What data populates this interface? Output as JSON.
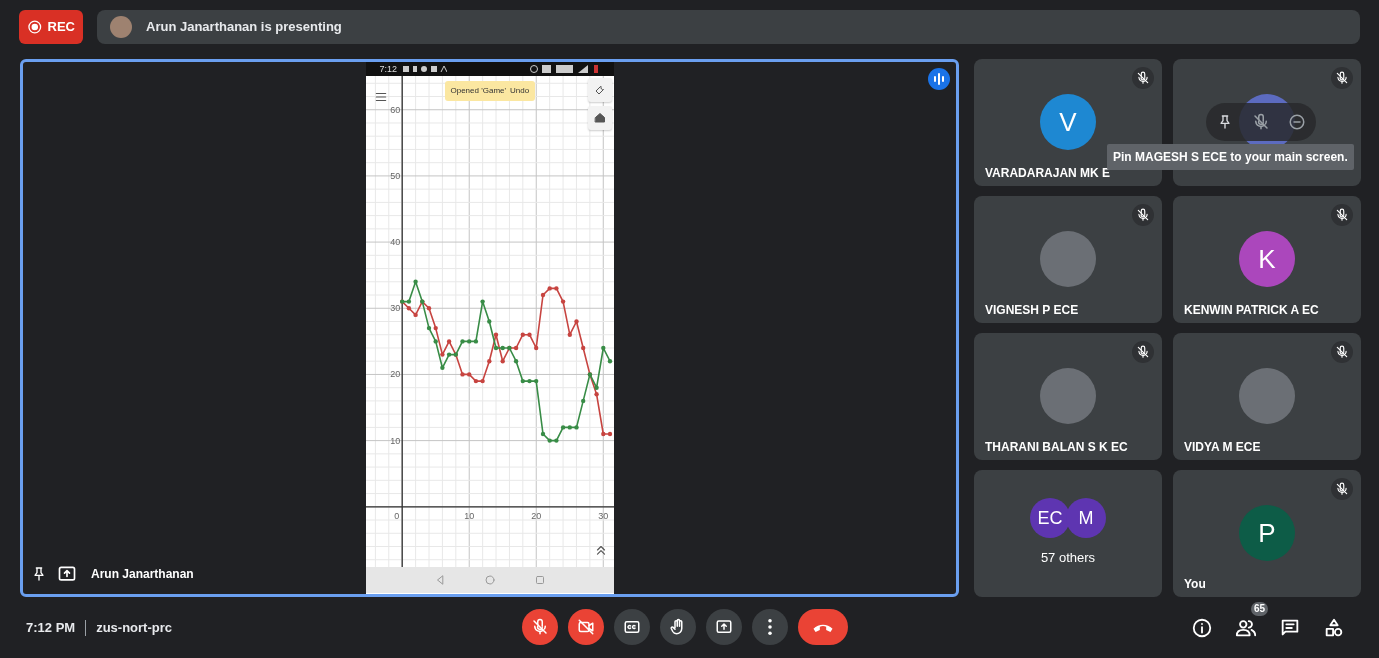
{
  "top_bar": {
    "rec_label": "REC",
    "presenting_text": "Arun Janarthanan is presenting"
  },
  "stage": {
    "presenter_name": "Arun Janarthanan",
    "shared_screen": {
      "status_time": "7:12",
      "toast": {
        "text": "Opened 'Game'",
        "action": "Undo"
      },
      "chart_data": {
        "type": "line",
        "grid": true,
        "xlim": [
          -5.4,
          31.6
        ],
        "ylim": [
          -9.1,
          65.1
        ],
        "xticks": [
          0,
          10,
          20,
          30
        ],
        "yticks": [
          10,
          20,
          30,
          40,
          50,
          60
        ],
        "x": [
          0,
          1,
          2,
          3,
          4,
          5,
          6,
          7,
          8,
          9,
          10,
          11,
          12,
          13,
          14,
          15,
          16,
          17,
          18,
          19,
          20,
          21,
          22,
          23,
          24,
          25,
          26,
          27,
          28,
          29,
          30,
          31
        ],
        "series": [
          {
            "color": "#c74440",
            "values": [
              31,
              30,
              29,
              31,
              30,
              27,
              23,
              25,
              23,
              20,
              20,
              19,
              19,
              22,
              26,
              22,
              24,
              24,
              26,
              26,
              24,
              32,
              33,
              33,
              31,
              26,
              28,
              24,
              20,
              17,
              11,
              11
            ]
          },
          {
            "color": "#388c46",
            "values": [
              31,
              31,
              34,
              31,
              27,
              25,
              21,
              23,
              23,
              25,
              25,
              25,
              31,
              28,
              24,
              24,
              24,
              22,
              19,
              19,
              19,
              11,
              10,
              10,
              12,
              12,
              12,
              16,
              20,
              18,
              24,
              22
            ]
          }
        ]
      }
    }
  },
  "tiles": [
    {
      "kind": "initial",
      "name": "VARADARAJAN MK E",
      "initial": "V",
      "color": "#1e88d2",
      "muted": true,
      "hovered": false
    },
    {
      "kind": "initial",
      "color": "#5c6bc0",
      "muted": true,
      "hovered": true
    },
    {
      "kind": "photo",
      "name": "VIGNESH P ECE",
      "muted": true,
      "hovered": false
    },
    {
      "kind": "initial",
      "name": "KENWIN PATRICK A EC",
      "initial": "K",
      "color": "#ab47bc",
      "muted": true,
      "hovered": false
    },
    {
      "kind": "photo",
      "name": "THARANI BALAN S K EC",
      "muted": true,
      "hovered": false
    },
    {
      "kind": "photo",
      "name": "VIDYA M ECE",
      "muted": true,
      "hovered": false
    },
    {
      "kind": "group",
      "avatars": [
        "EC",
        "M"
      ],
      "name": "57 others",
      "color": "#5e35b1",
      "muted": false,
      "hovered": false
    },
    {
      "kind": "initial",
      "name": "You",
      "initial": "P",
      "color": "#0d5c47",
      "muted": true,
      "hovered": false
    }
  ],
  "tooltip": "Pin MAGESH S ECE to your main screen.",
  "bottom_bar": {
    "time": "7:12 PM",
    "meeting_code": "zus-nort-prc",
    "mic_on": false,
    "camera_on": false,
    "people_count": "65"
  }
}
